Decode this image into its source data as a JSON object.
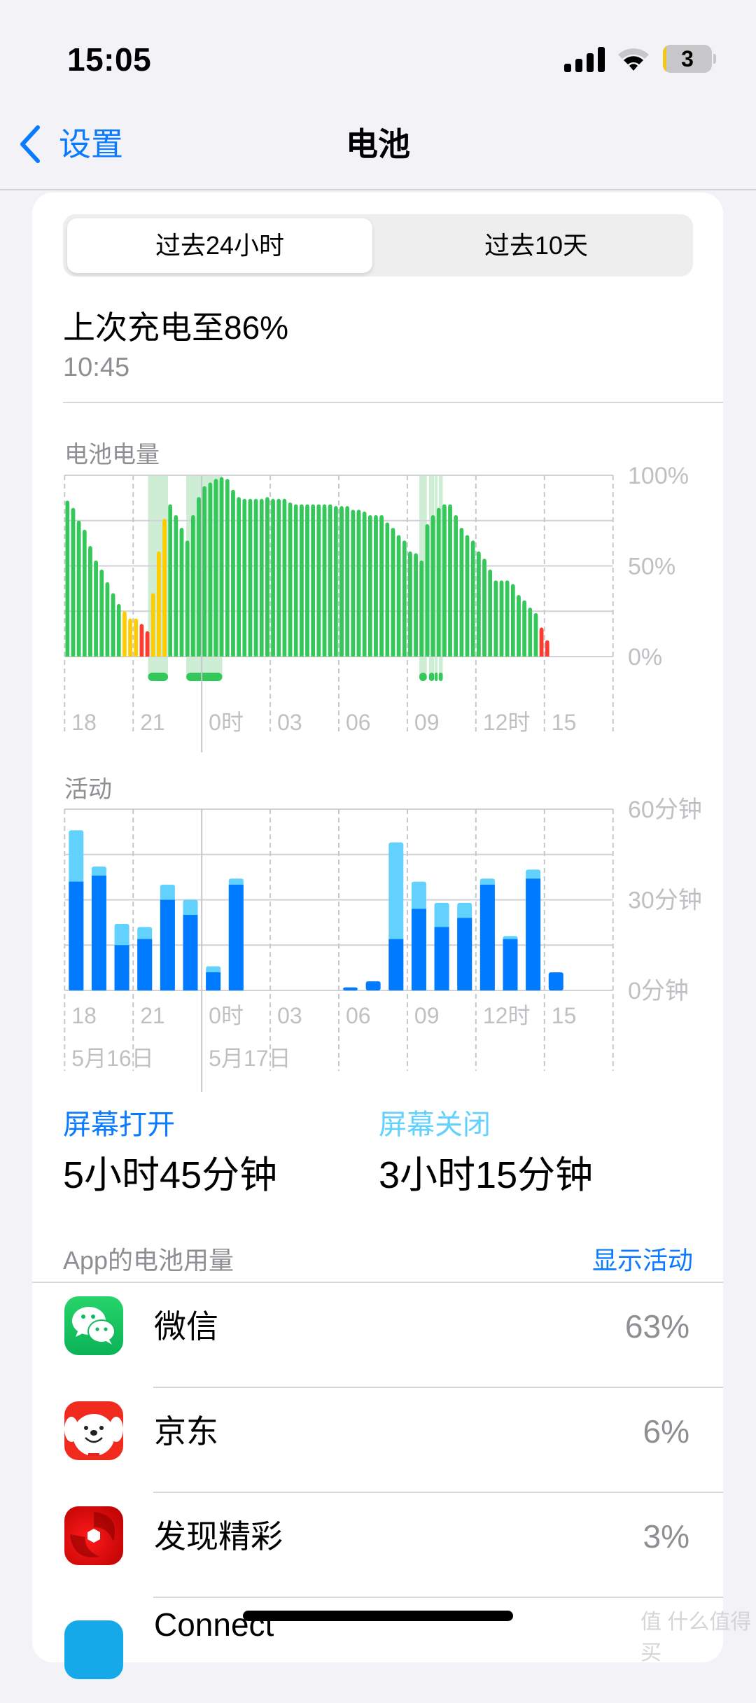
{
  "status_bar": {
    "time": "15:05",
    "battery_level_text": "3",
    "signal_bars": 4,
    "wifi": "on"
  },
  "nav": {
    "back_label": "设置",
    "title": "电池"
  },
  "segmented": {
    "options": [
      "过去24小时",
      "过去10天"
    ],
    "selected_index": 0
  },
  "last_charge": {
    "label": "上次充电至86%",
    "time": "10:45"
  },
  "colors": {
    "accent": "#0a7aff",
    "battery_green": "#34c759",
    "battery_yellow": "#ffcc00",
    "battery_red": "#ff3b30",
    "charging_zone": "#cdeed5",
    "screen_on": "#007aff",
    "screen_off": "#62d1fe"
  },
  "chart_data": [
    {
      "type": "bar",
      "title": "电池电量",
      "interval_minutes": 15,
      "x_start": "18:00",
      "x_tick_labels": [
        "18",
        "21",
        "0时",
        "03",
        "06",
        "09",
        "12时",
        "15"
      ],
      "y_tick_labels": [
        "100%",
        "50%",
        "0%"
      ],
      "ylim": [
        0,
        100
      ],
      "gridlines": [
        0,
        25,
        50,
        75,
        100
      ],
      "values": [
        86,
        82,
        75,
        70,
        61,
        53,
        48,
        41,
        35,
        29,
        25,
        21,
        21,
        18,
        14,
        35,
        58,
        76,
        84,
        78,
        71,
        64,
        78,
        88,
        94,
        96,
        98,
        99,
        98,
        92,
        88,
        87,
        87,
        87,
        87,
        88,
        87,
        87,
        87,
        85,
        84,
        84,
        84,
        84,
        84,
        84,
        84,
        83,
        83,
        83,
        81,
        81,
        80,
        78,
        78,
        78,
        74,
        71,
        67,
        64,
        58,
        57,
        53,
        73,
        78,
        82,
        84,
        84,
        78,
        71,
        67,
        64,
        58,
        54,
        48,
        42,
        42,
        42,
        40,
        34,
        31,
        27,
        24,
        16,
        9
      ],
      "bar_colors": [
        "g",
        "g",
        "g",
        "g",
        "g",
        "g",
        "g",
        "g",
        "g",
        "g",
        "y",
        "y",
        "y",
        "r",
        "r",
        "y",
        "y",
        "y",
        "g",
        "g",
        "g",
        "g",
        "g",
        "g",
        "g",
        "g",
        "g",
        "g",
        "g",
        "g",
        "g",
        "g",
        "g",
        "g",
        "g",
        "g",
        "g",
        "g",
        "g",
        "g",
        "g",
        "g",
        "g",
        "g",
        "g",
        "g",
        "g",
        "g",
        "g",
        "g",
        "g",
        "g",
        "g",
        "g",
        "g",
        "g",
        "g",
        "g",
        "g",
        "g",
        "g",
        "g",
        "g",
        "g",
        "g",
        "g",
        "g",
        "g",
        "g",
        "g",
        "g",
        "g",
        "g",
        "g",
        "g",
        "g",
        "g",
        "g",
        "g",
        "g",
        "g",
        "g",
        "g",
        "r",
        "r"
      ],
      "charging_ranges": [
        [
          14.6,
          18.1
        ],
        [
          21.3,
          27.6
        ],
        [
          62.1,
          63.4
        ],
        [
          63.8,
          64.7
        ],
        [
          64.8,
          65.3
        ],
        [
          65.5,
          66.2
        ]
      ]
    },
    {
      "type": "bar",
      "title": "活动",
      "stacked": true,
      "interval_minutes": 60,
      "x_start": "18:00",
      "x_tick_labels": [
        "18",
        "21",
        "0时",
        "03",
        "06",
        "09",
        "12时",
        "15"
      ],
      "date_labels": [
        "5月16日",
        "5月17日"
      ],
      "y_tick_labels": [
        "60分钟",
        "30分钟",
        "0分钟"
      ],
      "ylim": [
        0,
        60
      ],
      "gridlines": [
        0,
        15,
        30,
        45,
        60
      ],
      "series": [
        {
          "name": "屏幕打开",
          "values": [
            36,
            38,
            15,
            17,
            30,
            25,
            6,
            35,
            0,
            0,
            0,
            0,
            1,
            3,
            17,
            27,
            21,
            24,
            35,
            17,
            37,
            6
          ]
        },
        {
          "name": "屏幕关闭",
          "values": [
            17,
            3,
            7,
            4,
            5,
            5,
            2,
            2,
            0,
            0,
            0,
            0,
            0,
            0,
            32,
            9,
            8,
            5,
            2,
            1,
            3,
            0
          ]
        }
      ]
    }
  ],
  "stats": {
    "screen_on_label": "屏幕打开",
    "screen_on_value": "5小时45分钟",
    "screen_off_label": "屏幕关闭",
    "screen_off_value": "3小时15分钟"
  },
  "usage": {
    "header": "App的电池用量",
    "show_activity": "显示活动",
    "apps": [
      {
        "name": "微信",
        "percent": "63%",
        "icon": "wechat-icon"
      },
      {
        "name": "京东",
        "percent": "6%",
        "icon": "jd-icon"
      },
      {
        "name": "发现精彩",
        "percent": "3%",
        "icon": "discover-icon"
      },
      {
        "name": "Connect",
        "percent": "",
        "icon": "connect-icon"
      }
    ]
  },
  "watermark": "值 什么值得买"
}
